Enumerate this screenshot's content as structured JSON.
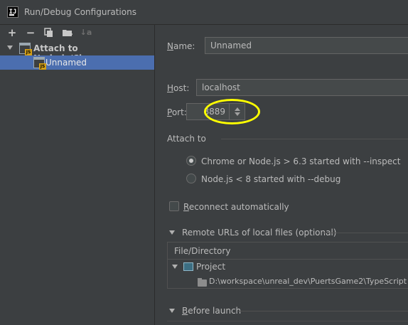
{
  "window": {
    "title": "Run/Debug Configurations",
    "app_icon_text": "IJ"
  },
  "toolbar": {
    "add": "+",
    "remove": "−",
    "copy": "copy-icon",
    "folder": "new-folder-icon",
    "sort": "↓a"
  },
  "tree": {
    "parent_label": "Attach to Node.js/Chrome",
    "child_label": "Unnamed",
    "icon_badge": "JS"
  },
  "form": {
    "name_label": "Name:",
    "name_label_mnemonic": "N",
    "name_label_rest": "ame:",
    "name_value": "Unnamed",
    "host_label_mnemonic": "H",
    "host_label_rest": "ost:",
    "host_value": "localhost",
    "port_label_mnemonic": "P",
    "port_label_rest": "ort:",
    "port_value": "8889",
    "attach_to_label": "Attach to",
    "radio_inspect": "Chrome or Node.js > 6.3 started with --inspect",
    "radio_debug": "Node.js < 8 started with --debug",
    "radio_selected": "inspect",
    "reconnect_mnemonic": "R",
    "reconnect_rest": "econnect automatically",
    "reconnect_checked": false,
    "remote_urls_label": "Remote URLs of local files (optional)",
    "table_header": "File/Directory",
    "project_label": "Project",
    "path_value": "D:\\workspace\\unreal_dev\\PuertsGame2\\TypeScript",
    "before_launch_mnemonic": "B",
    "before_launch_rest": "efore launch"
  },
  "colors": {
    "background": "#3c3f41",
    "selection": "#4b6eaf",
    "highlight_ring": "#ffff00"
  }
}
